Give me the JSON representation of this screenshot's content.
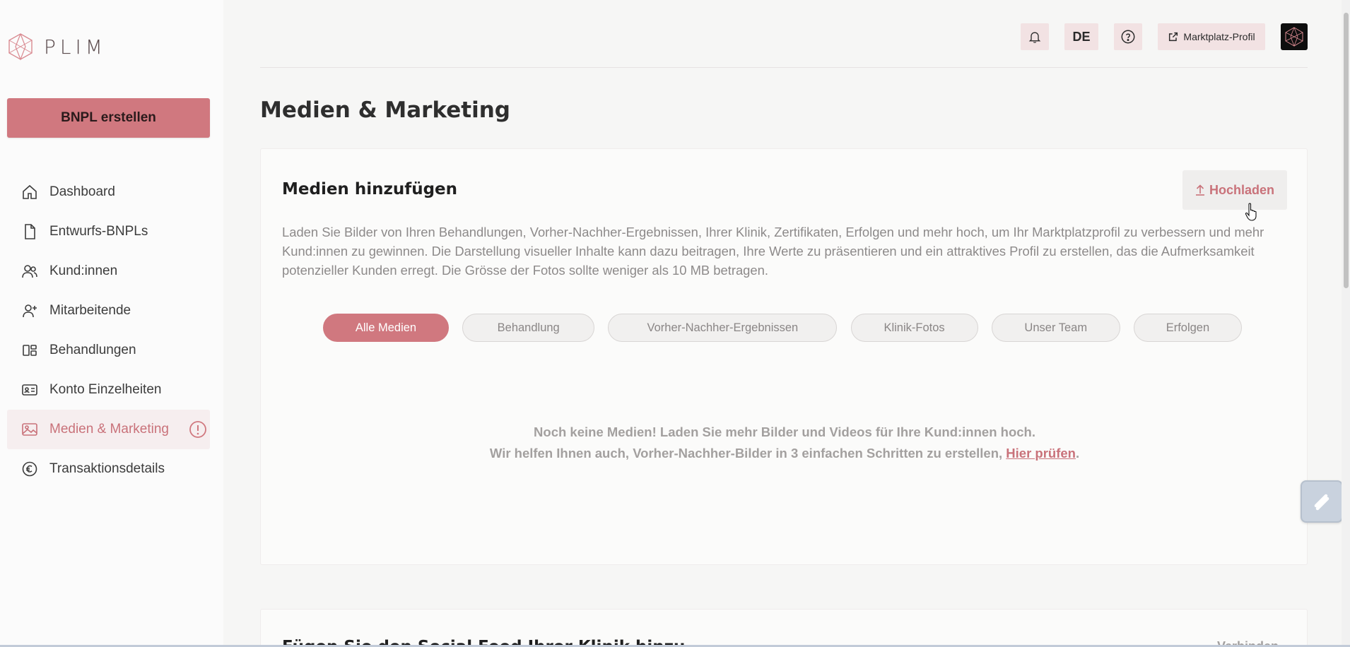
{
  "brand": {
    "name": "PLIM"
  },
  "sidebar": {
    "cta_label": "BNPL erstellen",
    "items": [
      {
        "label": "Dashboard",
        "icon": "home-icon"
      },
      {
        "label": "Entwurfs-BNPLs",
        "icon": "document-icon"
      },
      {
        "label": "Kund:innen",
        "icon": "users-icon"
      },
      {
        "label": "Mitarbeitende",
        "icon": "user-plus-icon"
      },
      {
        "label": "Behandlungen",
        "icon": "layout-icon"
      },
      {
        "label": "Konto Einzelheiten",
        "icon": "id-card-icon"
      },
      {
        "label": "Medien & Marketing",
        "icon": "image-icon",
        "active": true,
        "alert": true
      },
      {
        "label": "Transaktionsdetails",
        "icon": "euro-icon"
      }
    ]
  },
  "header": {
    "language": "DE",
    "marketplace_label": "Marktplatz-Profil"
  },
  "main": {
    "title": "Medien & Marketing",
    "media_card": {
      "title": "Medien hinzufügen",
      "upload_label": "Hochladen",
      "description": "Laden Sie Bilder von Ihren Behandlungen, Vorher-Nachher-Ergebnissen, Ihrer Klinik, Zertifikaten, Erfolgen und mehr hoch, um Ihr Marktplatzprofil zu verbessern und mehr Kund:innen zu gewinnen. Die Darstellung visueller Inhalte kann dazu beitragen, Ihre Werte zu präsentieren und ein attraktives Profil zu erstellen, das die Aufmerksamkeit potenzieller Kunden erregt. Die Grösse der Fotos sollte weniger als 10 MB betragen.",
      "filters": [
        "Alle Medien",
        "Behandlung",
        "Vorher-Nachher-Ergebnissen",
        "Klinik-Fotos",
        "Unser Team",
        "Erfolgen"
      ],
      "active_filter": "Alle Medien",
      "empty_line1": "Noch keine Medien! Laden Sie mehr Bilder und Videos für Ihre Kund:innen hoch.",
      "empty_line2_prefix": "Wir helfen Ihnen auch, Vorher-Nachher-Bilder in 3 einfachen Schritten zu erstellen, ",
      "empty_link": "Hier prüfen",
      "empty_line2_suffix": "."
    },
    "social_card": {
      "title": "Fügen Sie den Social Feed Ihrer Klinik hinzu",
      "action": "Verbinden"
    }
  },
  "colors": {
    "accent": "#d0787f",
    "accent_text": "#c9727a",
    "chip_bg": "#f1f0ef",
    "muted_text": "#8d8a8a"
  }
}
